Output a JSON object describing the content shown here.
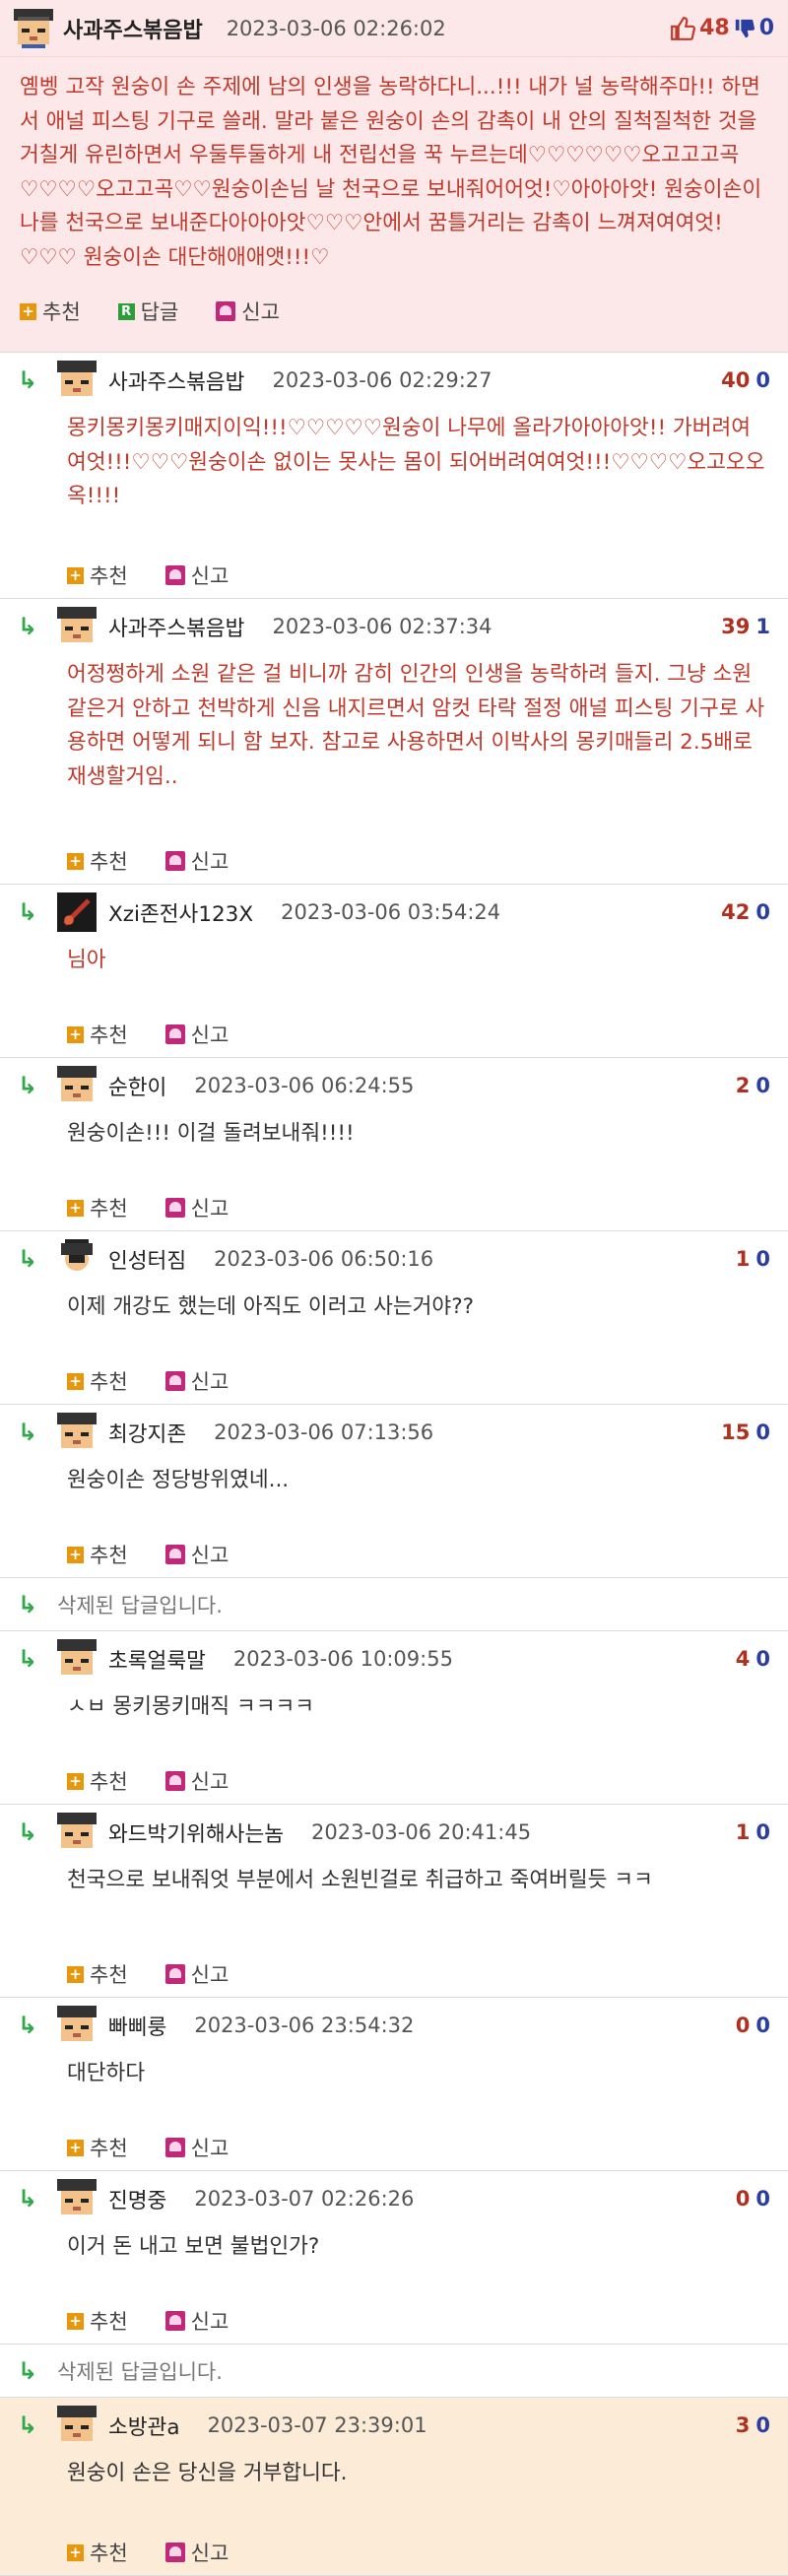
{
  "top": {
    "nick": "사과주스볶음밥",
    "date": "2023-03-06 02:26:02",
    "up": "48",
    "down": "0",
    "body": "옘벵 고작 원숭이 손 주제에 남의 인생을 농락하다니...!!! 내가 널 농락해주마!! 하면서 애널 피스팅 기구로 쓸래. 말라 붙은 원숭이 손의 감촉이 내 안의 질척질척한 것을 거칠게 유린하면서 우둘투둘하게 내 전립선을 꾹 누르는데♡♡♡♡♡♡오고고고곡♡♡♡♡오고고곡♡♡원숭이손님 날 천국으로 보내줘어어엇!♡아아아앗! 원숭이손이 나를 천국으로 보내준다아아아앗♡♡♡안에서 꿈틀거리는 감촉이 느껴져여여엇!♡♡♡ 원숭이손 대단해애애앳!!!♡",
    "recommend": "추천",
    "reply": "답글",
    "report": "신고"
  },
  "labels": {
    "recommend": "추천",
    "report": "신고",
    "deleted": "삭제된 답글입니다."
  },
  "replies": [
    {
      "nick": "사과주스볶음밥",
      "date": "2023-03-06 02:29:27",
      "up": "40",
      "down": "0",
      "body": "몽키몽키몽키매지이익!!!♡♡♡♡♡원숭이 나무에 올라가아아아앗!! 가버려여여엇!!!♡♡♡원숭이손 없이는 못사는 몸이 되어버려여여엇!!!♡♡♡♡오고오오옥!!!!"
    },
    {
      "nick": "사과주스볶음밥",
      "date": "2023-03-06 02:37:34",
      "up": "39",
      "down": "1",
      "body": "어정쩡하게 소원 같은 걸 비니까 감히 인간의 인생을 농락하려 들지. 그냥 소원 같은거 안하고 천박하게 신음 내지르면서 암컷 타락 절정 애널 피스팅 기구로 사용하면 어떻게 되니 함 보자. 참고로 사용하면서 이박사의 몽키매들리 2.5배로 재생할거임.."
    },
    {
      "nick": "Xzi존전사123X",
      "date": "2023-03-06 03:54:24",
      "up": "42",
      "down": "0",
      "body": "님아"
    },
    {
      "nick": "순한이",
      "date": "2023-03-06 06:24:55",
      "up": "2",
      "down": "0",
      "body": "원숭이손!!! 이걸 돌려보내줘!!!!"
    },
    {
      "nick": "인성터짐",
      "date": "2023-03-06 06:50:16",
      "up": "1",
      "down": "0",
      "body": "이제 개강도 했는데 아직도 이러고 사는거야??"
    },
    {
      "nick": "최강지존",
      "date": "2023-03-06 07:13:56",
      "up": "15",
      "down": "0",
      "body": "원숭이손 정당방위였네..."
    },
    {
      "nick": "초록얼룩말",
      "date": "2023-03-06 10:09:55",
      "up": "4",
      "down": "0",
      "body": "ㅅㅂ 몽키몽키매직 ㅋㅋㅋㅋ"
    },
    {
      "nick": "와드박기위해사는놈",
      "date": "2023-03-06 20:41:45",
      "up": "1",
      "down": "0",
      "body": "천국으로 보내줘엇 부분에서 소원빈걸로 취급하고 죽여버릴듯 ㅋㅋ"
    },
    {
      "nick": "빠삐룽",
      "date": "2023-03-06 23:54:32",
      "up": "0",
      "down": "0",
      "body": "대단하다"
    },
    {
      "nick": "진명중",
      "date": "2023-03-07 02:26:26",
      "up": "0",
      "down": "0",
      "body": "이거 돈 내고 보면 불법인가?"
    },
    {
      "nick": "소방관a",
      "date": "2023-03-07 23:39:01",
      "up": "3",
      "down": "0",
      "body": "원숭이 손은 당신을 거부합니다."
    }
  ]
}
